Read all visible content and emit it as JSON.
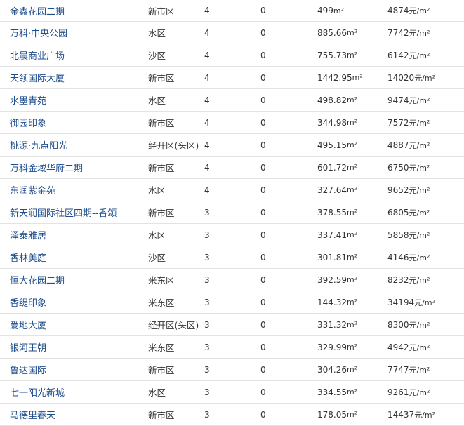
{
  "rows": [
    {
      "name": "金鑫花园二期",
      "area": "新市区",
      "col3": "4",
      "col4": "0",
      "size": "499",
      "size_unit": "m²",
      "price": "4874",
      "price_unit": "元/m²"
    },
    {
      "name": "万科·中央公园",
      "area": "水区",
      "col3": "4",
      "col4": "0",
      "size": "885.66",
      "size_unit": "m²",
      "price": "7742",
      "price_unit": "元/m²"
    },
    {
      "name": "北晨商业广场",
      "area": "沙区",
      "col3": "4",
      "col4": "0",
      "size": "755.73",
      "size_unit": "m²",
      "price": "6142",
      "price_unit": "元/m²"
    },
    {
      "name": "天领国际大厦",
      "area": "新市区",
      "col3": "4",
      "col4": "0",
      "size": "1442.95",
      "size_unit": "m²",
      "price": "14020",
      "price_unit": "元/m²"
    },
    {
      "name": "水墨青苑",
      "area": "水区",
      "col3": "4",
      "col4": "0",
      "size": "498.82",
      "size_unit": "m²",
      "price": "9474",
      "price_unit": "元/m²"
    },
    {
      "name": "御园印象",
      "area": "新市区",
      "col3": "4",
      "col4": "0",
      "size": "344.98",
      "size_unit": "m²",
      "price": "7572",
      "price_unit": "元/m²"
    },
    {
      "name": "桃源·九点阳光",
      "area": "经开区(头区)",
      "col3": "4",
      "col4": "0",
      "size": "495.15",
      "size_unit": "m²",
      "price": "4887",
      "price_unit": "元/m²"
    },
    {
      "name": "万科金域华府二期",
      "area": "新市区",
      "col3": "4",
      "col4": "0",
      "size": "601.72",
      "size_unit": "m²",
      "price": "6750",
      "price_unit": "元/m²"
    },
    {
      "name": "东润紫金苑",
      "area": "水区",
      "col3": "4",
      "col4": "0",
      "size": "327.64",
      "size_unit": "m²",
      "price": "9652",
      "price_unit": "元/m²"
    },
    {
      "name": "新天润国际社区四期--香颂",
      "area": "新市区",
      "col3": "3",
      "col4": "0",
      "size": "378.55",
      "size_unit": "m²",
      "price": "6805",
      "price_unit": "元/m²"
    },
    {
      "name": "泽泰雅居",
      "area": "水区",
      "col3": "3",
      "col4": "0",
      "size": "337.41",
      "size_unit": "m²",
      "price": "5858",
      "price_unit": "元/m²"
    },
    {
      "name": "香林美庭",
      "area": "沙区",
      "col3": "3",
      "col4": "0",
      "size": "301.81",
      "size_unit": "m²",
      "price": "4146",
      "price_unit": "元/m²"
    },
    {
      "name": "恒大花园二期",
      "area": "米东区",
      "col3": "3",
      "col4": "0",
      "size": "392.59",
      "size_unit": "m²",
      "price": "8232",
      "price_unit": "元/m²"
    },
    {
      "name": "香缇印象",
      "area": "米东区",
      "col3": "3",
      "col4": "0",
      "size": "144.32",
      "size_unit": "m²",
      "price": "34194",
      "price_unit": "元/m²"
    },
    {
      "name": "爱地大厦",
      "area": "经开区(头区)",
      "col3": "3",
      "col4": "0",
      "size": "331.32",
      "size_unit": "m²",
      "price": "8300",
      "price_unit": "元/m²"
    },
    {
      "name": "银河王朝",
      "area": "米东区",
      "col3": "3",
      "col4": "0",
      "size": "329.99",
      "size_unit": "m²",
      "price": "4942",
      "price_unit": "元/m²"
    },
    {
      "name": "鲁达国际",
      "area": "新市区",
      "col3": "3",
      "col4": "0",
      "size": "304.26",
      "size_unit": "m²",
      "price": "7747",
      "price_unit": "元/m²"
    },
    {
      "name": "七一阳光新城",
      "area": "水区",
      "col3": "3",
      "col4": "0",
      "size": "334.55",
      "size_unit": "m²",
      "price": "9261",
      "price_unit": "元/m²"
    },
    {
      "name": "马德里春天",
      "area": "新市区",
      "col3": "3",
      "col4": "0",
      "size": "178.05",
      "size_unit": "m²",
      "price": "14437",
      "price_unit": "元/m²"
    }
  ]
}
